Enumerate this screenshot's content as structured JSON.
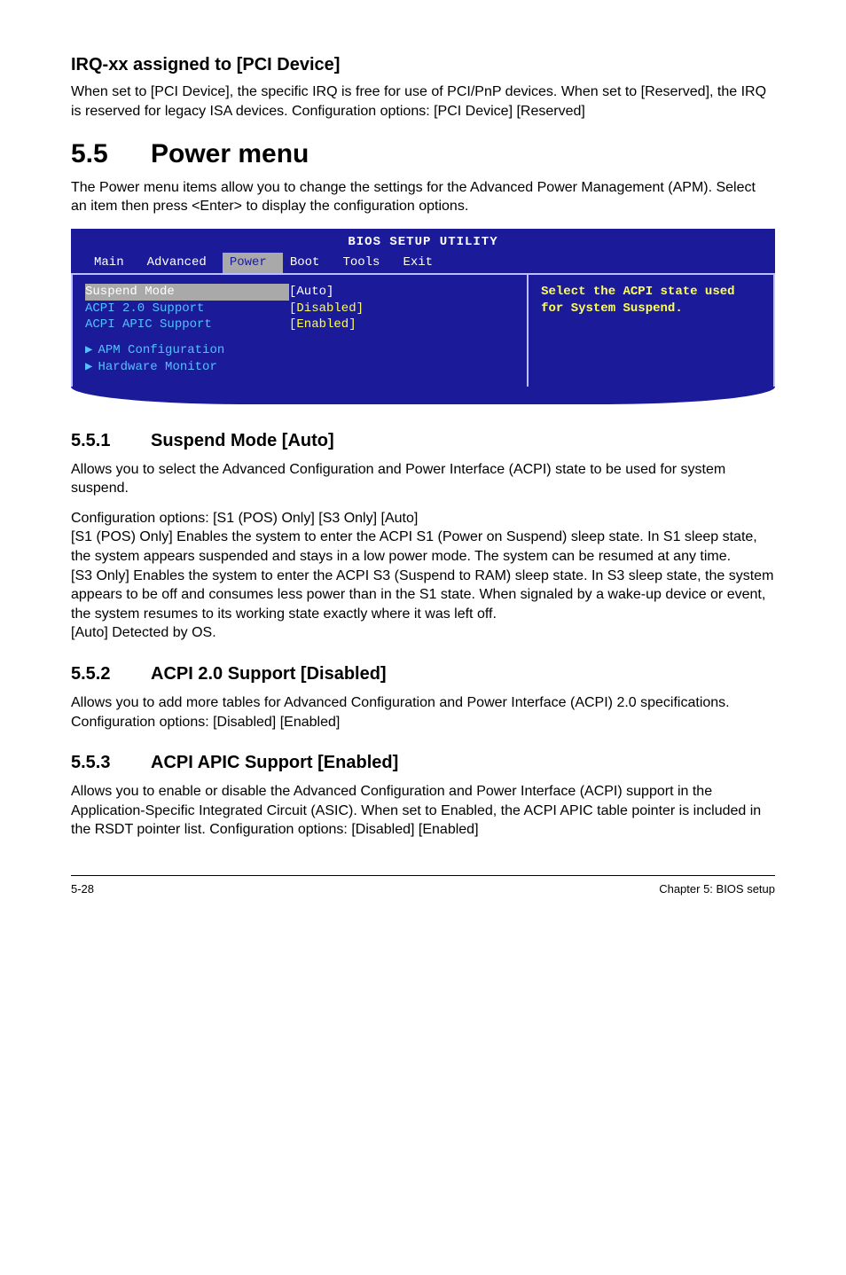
{
  "irq": {
    "title": "IRQ-xx assigned to [PCI Device]",
    "p": "When set to [PCI Device], the specific IRQ is free for use of PCI/PnP devices. When set to [Reserved], the IRQ is reserved for legacy ISA devices. Configuration options: [PCI Device] [Reserved]"
  },
  "power_heading_num": "5.5",
  "power_heading_text": "Power menu",
  "power_intro": "The Power menu items allow you to change the settings for the Advanced Power Management (APM). Select an item then press <Enter> to display the configuration options.",
  "bios": {
    "title": "BIOS SETUP UTILITY",
    "tabs": [
      "Main",
      "Advanced",
      "Power",
      "Boot",
      "Tools",
      "Exit"
    ],
    "active_tab": "Power",
    "rows": [
      {
        "label": "Suspend Mode",
        "value": "[Auto]",
        "selected": true
      },
      {
        "label": "ACPI 2.0 Support",
        "value": "[Disabled]",
        "selected": false
      },
      {
        "label": "ACPI APIC Support",
        "value": "[Enabled]",
        "selected": false
      }
    ],
    "subs": [
      "APM Configuration",
      "Hardware Monitor"
    ],
    "help": "Select the ACPI state used for System Suspend."
  },
  "s551": {
    "h_num": "5.5.1",
    "h_text": "Suspend Mode [Auto]",
    "p1": "Allows you to select the Advanced Configuration and Power Interface (ACPI) state to be used for system suspend.",
    "p2": "Configuration options: [S1 (POS) Only] [S3 Only] [Auto]",
    "p3": "[S1 (POS) Only] Enables the system to enter the ACPI S1 (Power on Suspend) sleep state. In S1 sleep state, the system appears suspended and stays in a low power mode. The system can be resumed at any time.",
    "p4": "[S3 Only] Enables the system to enter the ACPI S3 (Suspend to RAM) sleep state. In S3 sleep state, the system appears to be off and consumes less power than in the S1 state. When signaled by a wake-up device or event, the system resumes to its  working state exactly where it was left off.",
    "p5": "[Auto] Detected by OS."
  },
  "s552": {
    "h_num": "5.5.2",
    "h_text": "ACPI 2.0 Support [Disabled]",
    "p1": "Allows you to add more tables for Advanced Configuration and Power Interface (ACPI) 2.0 specifications.",
    "p2": "Configuration options: [Disabled] [Enabled]"
  },
  "s553": {
    "h_num": "5.5.3",
    "h_text": "ACPI APIC Support [Enabled]",
    "p1": "Allows you to enable or disable the Advanced Configuration and Power Interface (ACPI) support in the Application-Specific Integrated Circuit (ASIC). When set to Enabled, the ACPI APIC table pointer is included in the RSDT pointer list. Configuration options: [Disabled] [Enabled]"
  },
  "footer": {
    "page": "5-28",
    "chapter": "Chapter 5: BIOS setup"
  }
}
